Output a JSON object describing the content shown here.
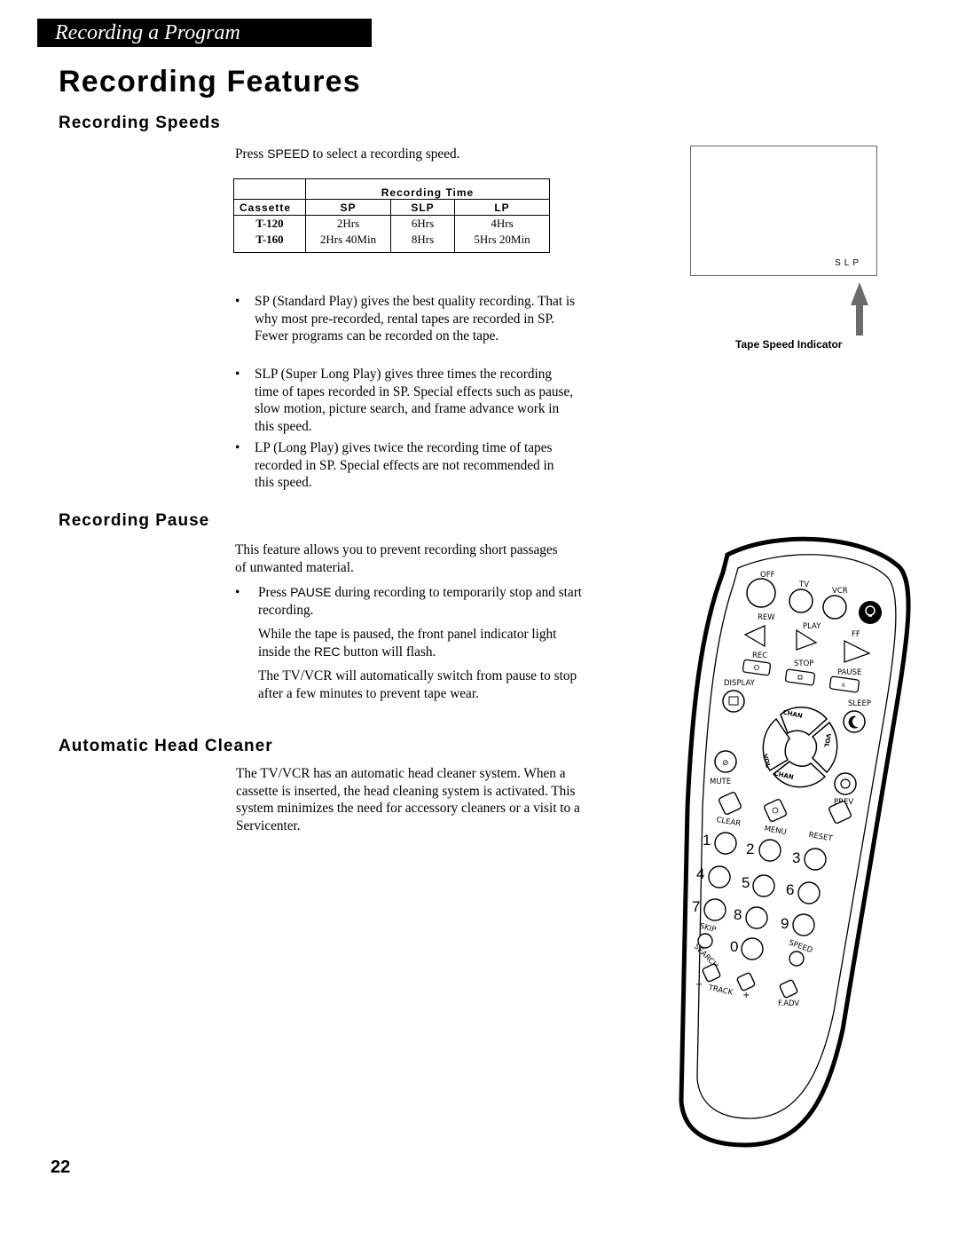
{
  "header": {
    "section_banner": "Recording a Program",
    "page_title": "Recording Features"
  },
  "speeds": {
    "heading": "Recording Speeds",
    "intro_pre": "Press ",
    "intro_key": "SPEED",
    "intro_post": " to select a recording speed.",
    "table": {
      "group_header": "Recording Time",
      "columns": [
        "Cassette",
        "SP",
        "SLP",
        "LP"
      ],
      "rows": [
        [
          "T-120",
          "2Hrs",
          "6Hrs",
          "4Hrs"
        ],
        [
          "T-160",
          "2Hrs 40Min",
          "8Hrs",
          "5Hrs 20Min"
        ]
      ]
    },
    "bullets": [
      "SP (Standard Play) gives the best quality recording. That is why most pre-recorded, rental tapes are recorded in SP.  Fewer programs can be recorded on the tape.",
      "SLP (Super Long Play) gives three times the recording time of tapes recorded in SP. Special effects such as pause, slow motion, picture search, and frame advance work in this speed.",
      "LP (Long Play) gives twice the recording time of tapes recorded in SP. Special effects are not recommended in this speed."
    ],
    "bullet_glyph": "•"
  },
  "figure": {
    "screen_indicator": "SLP",
    "caption": "Tape Speed Indicator"
  },
  "pause": {
    "heading": "Recording Pause",
    "intro": "This feature allows you to prevent recording short passages of unwanted material.",
    "bullet_pre": "Press ",
    "bullet_key": "PAUSE",
    "bullet_post": " during recording to temporarily stop and start recording.",
    "para1_pre": "While the tape is paused, the front panel indicator light inside the ",
    "para1_key": "REC",
    "para1_post": " button will flash.",
    "para2": "The TV/VCR will automatically switch from pause to stop after a few minutes to prevent tape wear."
  },
  "cleaner": {
    "heading": "Automatic Head Cleaner",
    "body": "The TV/VCR has an automatic head cleaner system. When a cassette is inserted, the head cleaning system is activated. This system minimizes the need for accessory cleaners or a visit to a Servicenter."
  },
  "remote": {
    "labels": {
      "off": "OFF",
      "tv": "TV",
      "vcr": "VCR",
      "rew": "REW",
      "play": "PLAY",
      "ff": "FF",
      "rec": "REC",
      "stop": "STOP",
      "pause": "PAUSE",
      "display": "DISPLAY",
      "sleep": "SLEEP",
      "chan": "CHAN",
      "vol": "VOL",
      "mute": "MUTE",
      "prev": "PREV",
      "clear": "CLEAR",
      "menu": "MENU",
      "reset": "RESET",
      "skip": "SKIP",
      "search": "SEARCH",
      "speed": "SPEED",
      "track": "TRACK",
      "minus": "−",
      "plus": "+",
      "fadv": "F.ADV"
    },
    "digits": [
      "1",
      "2",
      "3",
      "4",
      "5",
      "6",
      "7",
      "8",
      "9",
      "0"
    ]
  },
  "footer": {
    "page_number": "22"
  }
}
